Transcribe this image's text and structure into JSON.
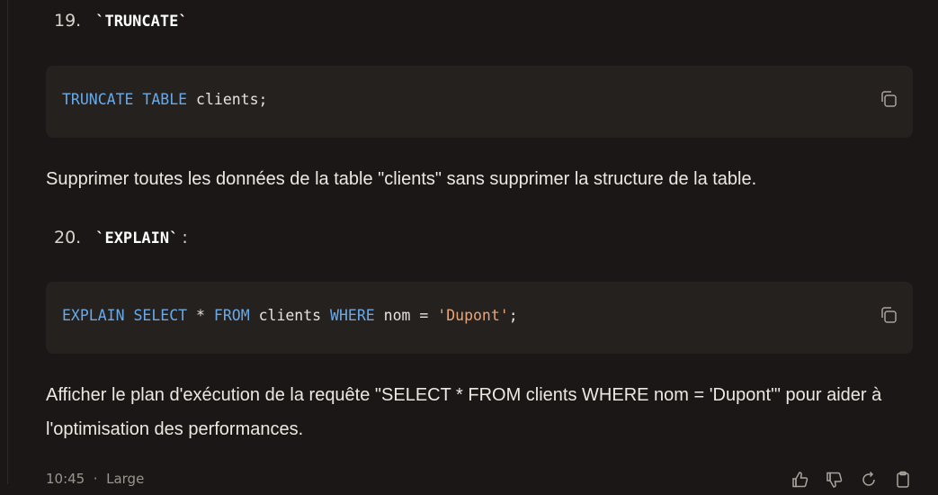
{
  "items": [
    {
      "number": "19.",
      "command": "`TRUNCATE`",
      "colon": "",
      "code": {
        "kw1": "TRUNCATE TABLE",
        "rest": " clients;"
      },
      "description": "Supprimer toutes les données de la table \"clients\" sans supprimer la structure de la table."
    },
    {
      "number": "20.",
      "command": "`EXPLAIN`",
      "colon": ":",
      "code": {
        "kw1": "EXPLAIN SELECT",
        "op": " * ",
        "kw2": "FROM",
        "tbl": " clients ",
        "kw3": "WHERE",
        "col": " nom = ",
        "str": "'Dupont'",
        "end": ";"
      },
      "description": "Afficher le plan d'exécution de la requête \"SELECT * FROM clients WHERE nom = 'Dupont'\" pour aider à l'optimisation des performances."
    }
  ],
  "footer": {
    "time": "10:45",
    "separator": "·",
    "model": "Large"
  },
  "icons": {
    "copy": "copy-icon",
    "thumbs_up": "thumbs-up-icon",
    "thumbs_down": "thumbs-down-icon",
    "regenerate": "regenerate-icon",
    "clipboard": "clipboard-icon"
  },
  "colors": {
    "background": "#1a1716",
    "code_background": "#24211f",
    "keyword": "#6aa9e8",
    "string": "#e8a678"
  }
}
